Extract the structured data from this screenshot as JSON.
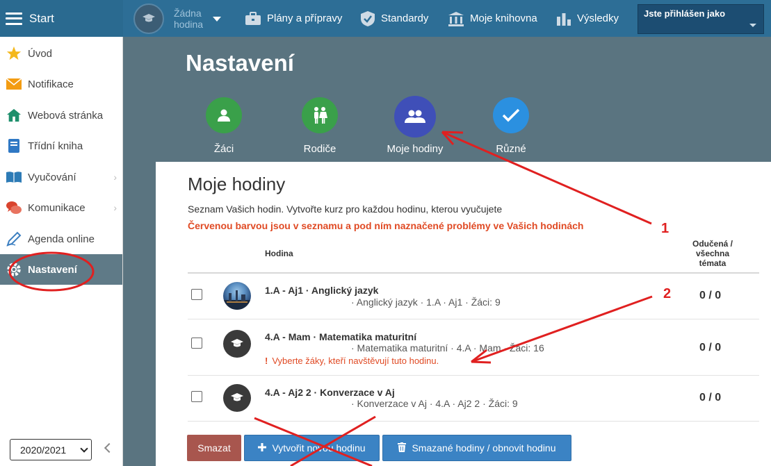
{
  "topbar": {
    "start_label": "Start",
    "lesson_selector": "Žádna hodina",
    "nav": [
      {
        "label": "Plány a přípravy"
      },
      {
        "label": "Standardy"
      },
      {
        "label": "Moje knihovna"
      },
      {
        "label": "Výsledky"
      }
    ],
    "login_label": "Jste přihlášen jako"
  },
  "sidebar": {
    "items": [
      {
        "label": "Úvod"
      },
      {
        "label": "Notifikace"
      },
      {
        "label": "Webová stránka"
      },
      {
        "label": "Třídní kniha"
      },
      {
        "label": "Vyučování"
      },
      {
        "label": "Komunikace"
      },
      {
        "label": "Agenda online"
      },
      {
        "label": "Nastavení"
      }
    ],
    "school_year": "2020/2021"
  },
  "header": {
    "title": "Nastavení",
    "tabs": [
      {
        "label": "Žáci",
        "color": "#3aa04a"
      },
      {
        "label": "Rodiče",
        "color": "#3aa04a"
      },
      {
        "label": "Moje hodiny",
        "color": "#3f4fb8"
      },
      {
        "label": "Různé",
        "color": "#2b90e0"
      }
    ]
  },
  "content": {
    "title": "Moje hodiny",
    "description": "Seznam Vašich hodin. Vytvořte kurz pro každou hodinu, kterou vyučujete",
    "warning": "Červenou barvou jsou v seznamu a pod ním naznačené problémy ve Vašich hodinách",
    "col_hodina": "Hodina",
    "col_odu": "Odučená / všechna témata",
    "rows": [
      {
        "title": "1.A - Aj1 · Anglický jazyk",
        "subtitle": "· Anglický jazyk · 1.A · Aj1 · Žáci: 9",
        "score": "0 / 0"
      },
      {
        "title": "4.A - Mam · Matematika maturitní",
        "subtitle": "· Matematika maturitní · 4.A · Mam · Žáci: 16",
        "error": "Vyberte žáky, kteří navštěvují tuto hodinu.",
        "score": "0 / 0"
      },
      {
        "title": "4.A - Aj2 2 · Konverzace v Aj",
        "subtitle": "· Konverzace v Aj · 4.A · Aj2 2 · Žáci: 9",
        "score": "0 / 0"
      }
    ],
    "buttons": {
      "delete": "Smazat",
      "create": "Vytvořit novou hodinu",
      "restore": "Smazané hodiny / obnovit hodinu"
    }
  },
  "annotations": {
    "num1": "1",
    "num2": "2",
    "color": "#e02020"
  }
}
